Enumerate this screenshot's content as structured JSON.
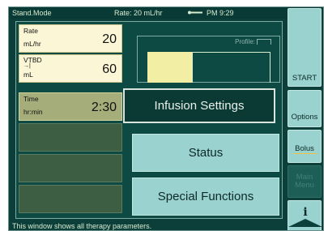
{
  "status": {
    "mode": "Stand.Mode",
    "rate": "Rate: 20 mL/hr",
    "time": "PM 9:29",
    "battery_icon": "battery-icon"
  },
  "params": [
    {
      "label": "Rate",
      "unit": "mL/hr",
      "value": "20",
      "selected": false
    },
    {
      "label": "VTBD",
      "unit": "mL",
      "value": "60",
      "selected": false
    },
    {
      "label": "Time",
      "unit": "hr:min",
      "value": "2:30",
      "selected": true
    }
  ],
  "chart": {
    "profile_label": "Profile:",
    "fill_fraction": 0.36
  },
  "menu": {
    "infusion_settings": "Infusion Settings",
    "status": "Status",
    "special_functions": "Special Functions"
  },
  "side": {
    "start": "START",
    "options": "Options",
    "bolus": "Bolus",
    "main_menu": "Main Menu",
    "info": "i"
  },
  "help_text": "This window shows all therapy parameters.",
  "colors": {
    "screen_bg": "#0c3f3a",
    "param_bg": "#fbf7d6",
    "param_selected_bg": "#a5ad7a",
    "button_light": "#9ad2cf",
    "chart_fill": "#f2eea4",
    "bolus_accent": "#f0c040"
  }
}
